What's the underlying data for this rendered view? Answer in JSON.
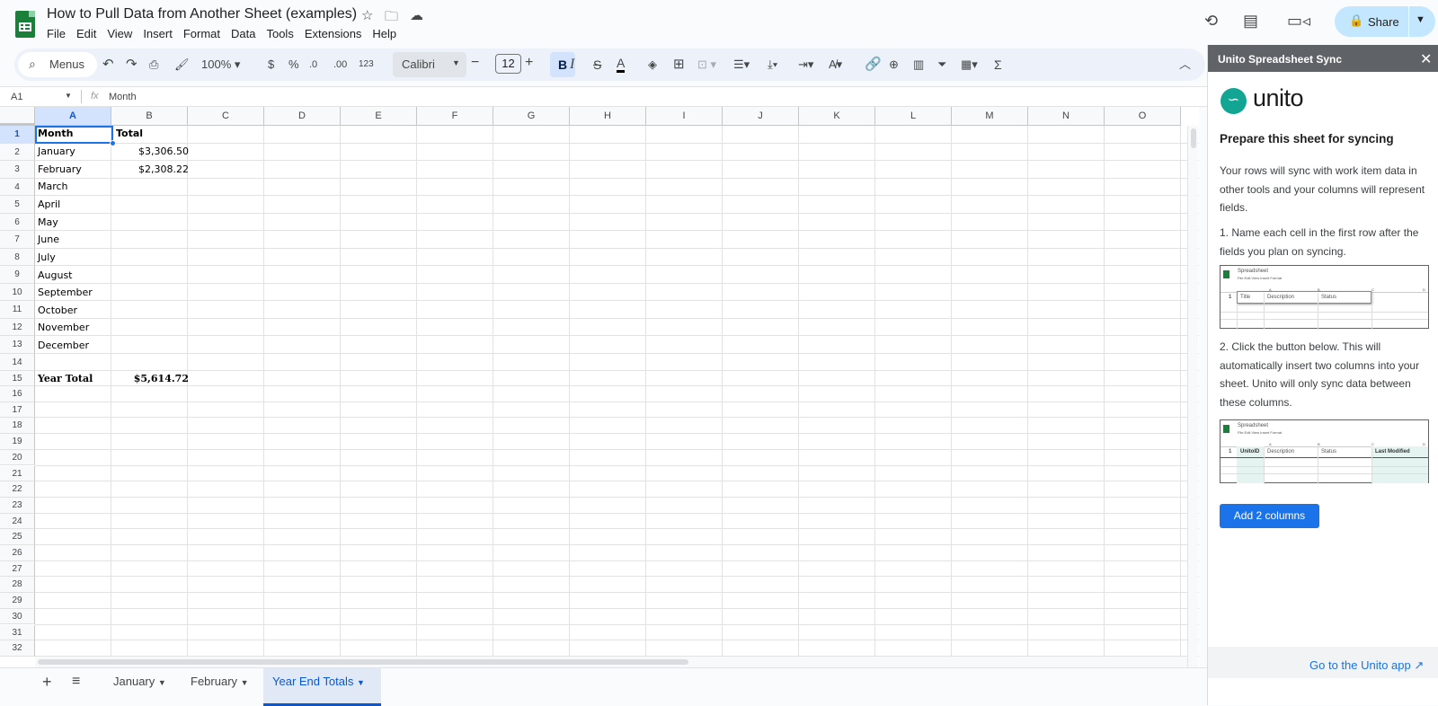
{
  "doc": {
    "title": "How to Pull Data from Another Sheet (examples)"
  },
  "menubar": [
    "File",
    "Edit",
    "View",
    "Insert",
    "Format",
    "Data",
    "Tools",
    "Extensions",
    "Help"
  ],
  "share": {
    "label": "Share"
  },
  "toolbar": {
    "menus_label": "Menus",
    "zoom": "100%",
    "currency": "$",
    "percent": "%",
    "dec_decrease": ".0",
    "dec_increase": ".00",
    "number_format": "123",
    "font": "Calibri",
    "font_size": "12",
    "bold": "B",
    "italic": "I",
    "strike": "S",
    "text_color": "A",
    "sum": "Σ"
  },
  "formula_bar": {
    "cell_ref": "A1",
    "fx": "fx",
    "content": "Month"
  },
  "columns": [
    "A",
    "B",
    "C",
    "D",
    "E",
    "F",
    "G",
    "H",
    "I",
    "J",
    "K",
    "L",
    "M",
    "N",
    "O"
  ],
  "rows": [
    "1",
    "2",
    "3",
    "4",
    "5",
    "6",
    "7",
    "8",
    "9",
    "10",
    "11",
    "12",
    "13",
    "14",
    "15",
    "16",
    "17",
    "18",
    "19",
    "20",
    "21",
    "22",
    "23",
    "24",
    "25",
    "26",
    "27",
    "28",
    "29",
    "30",
    "31",
    "32"
  ],
  "cells": {
    "a1": "Month",
    "b1": "Total",
    "a2": "January",
    "b2": "$3,306.50",
    "a3": "February",
    "b3": "$2,308.22",
    "a4": "March",
    "a5": "April",
    "a6": "May",
    "a7": "June",
    "a8": "July",
    "a9": "August",
    "a10": "September",
    "a11": "October",
    "a12": "November",
    "a13": "December",
    "a15": "Year Total",
    "b15": "$5,614.72"
  },
  "sheet_tabs": [
    {
      "label": "January",
      "active": false
    },
    {
      "label": "February",
      "active": false
    },
    {
      "label": "Year End Totals",
      "active": true
    }
  ],
  "sidebar": {
    "title": "Unito Spreadsheet Sync",
    "logo_word": "unito",
    "heading": "Prepare this sheet for syncing",
    "para1": "Your rows will sync with work item data in other tools and your columns will represent fields.",
    "step1": "1. Name each cell in the first row after the fields you plan on syncing.",
    "mini1": {
      "app": "Spreadsheet",
      "menu": "File  Edit  View  Insert  Format",
      "cols": [
        "A",
        "B",
        "C",
        "D"
      ],
      "row": "1",
      "headers": [
        "Title",
        "Description",
        "Status"
      ]
    },
    "step2": "2. Click the button below. This will automatically insert two columns into your sheet. Unito will only sync data between these columns.",
    "mini2": {
      "app": "Spreadsheet",
      "menu": "File  Edit  View  Insert  Format",
      "cols": [
        "A",
        "B",
        "C",
        "D"
      ],
      "row": "1",
      "headers": [
        "UnitoID",
        "Description",
        "Status",
        "Last Modified"
      ]
    },
    "button": "Add 2 columns",
    "footer_link": "Go to the Unito app"
  },
  "colors": {
    "accent": "#0b57d0",
    "selection": "#1a73e8",
    "unito_teal": "#12a594",
    "sheets_green": "#188038"
  }
}
